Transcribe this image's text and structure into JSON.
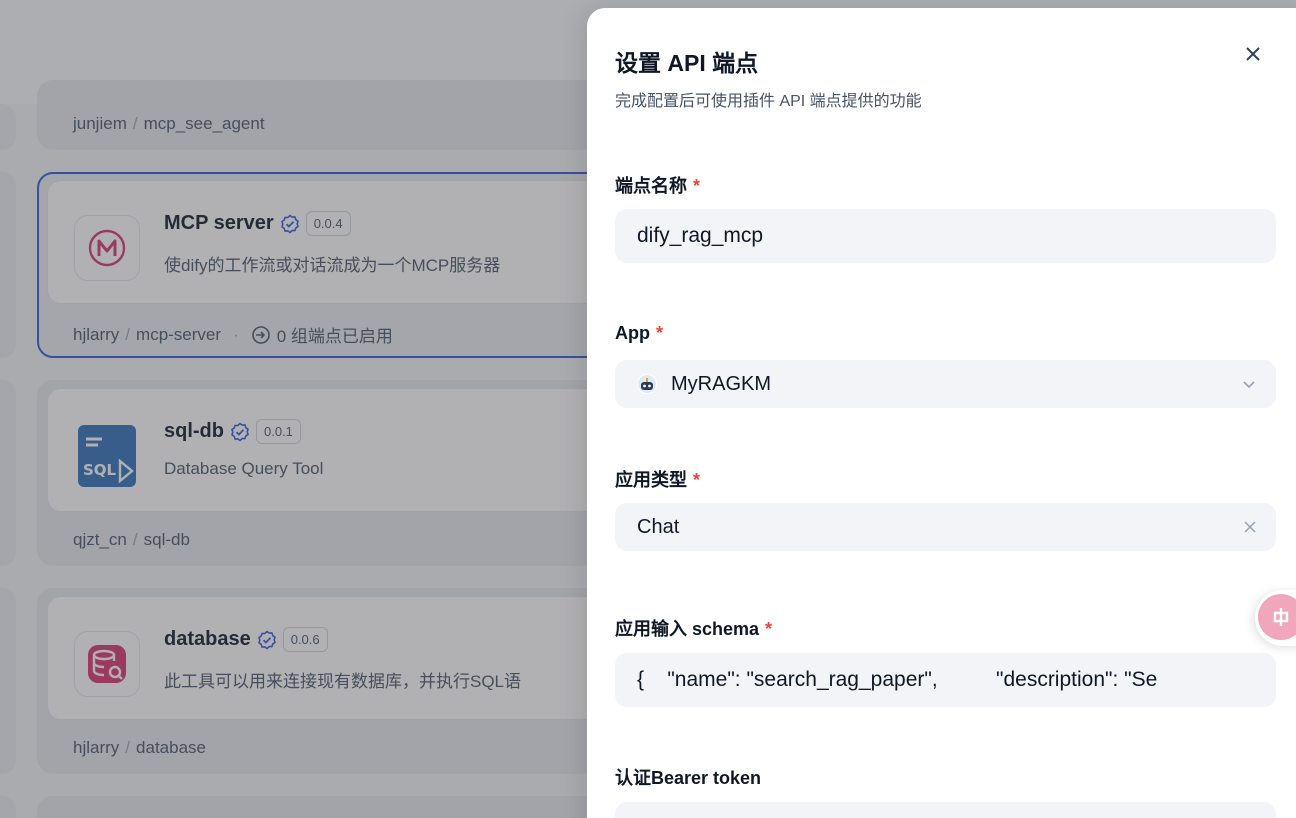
{
  "plugins": [
    {
      "author": "junjiem",
      "slug": "mcp_see_agent"
    },
    {
      "name": "MCP server",
      "version": "0.0.4",
      "description": "使dify的工作流或对话流成为一个MCP服务器",
      "author": "hjlarry",
      "slug": "mcp-server",
      "endpoints": "0 组端点已启用",
      "icon": "mcp-logo-icon",
      "color": "#d6336c"
    },
    {
      "name": "sql-db",
      "version": "0.0.1",
      "description": "Database Query Tool",
      "author": "qjzt_cn",
      "slug": "sql-db",
      "icon": "sql-logo-icon",
      "icon_text": "SQL",
      "color": "#2e6fb7"
    },
    {
      "name": "database",
      "version": "0.0.6",
      "description": "此工具可以用来连接现有数据库，并执行SQL语",
      "author": "hjlarry",
      "slug": "database",
      "icon": "database-logo-icon",
      "color": "#d6336c"
    }
  ],
  "drawer": {
    "title": "设置 API 端点",
    "subtitle": "完成配置后可使用插件 API 端点提供的功能",
    "required_mark": "*",
    "fields": {
      "endpoint_name": {
        "label": "端点名称",
        "value": "dify_rag_mcp"
      },
      "app": {
        "label": "App",
        "value": "MyRAGKM"
      },
      "app_type": {
        "label": "应用类型",
        "value": "Chat"
      },
      "schema": {
        "label": "应用输入 schema",
        "value": "{    \"name\": \"search_rag_paper\",          \"description\": \"Se"
      },
      "token": {
        "label": "认证Bearer token",
        "value": ""
      }
    }
  },
  "colors": {
    "accent": "#2f5bd9",
    "required": "#f04438",
    "verified": "#2f5bd9"
  }
}
